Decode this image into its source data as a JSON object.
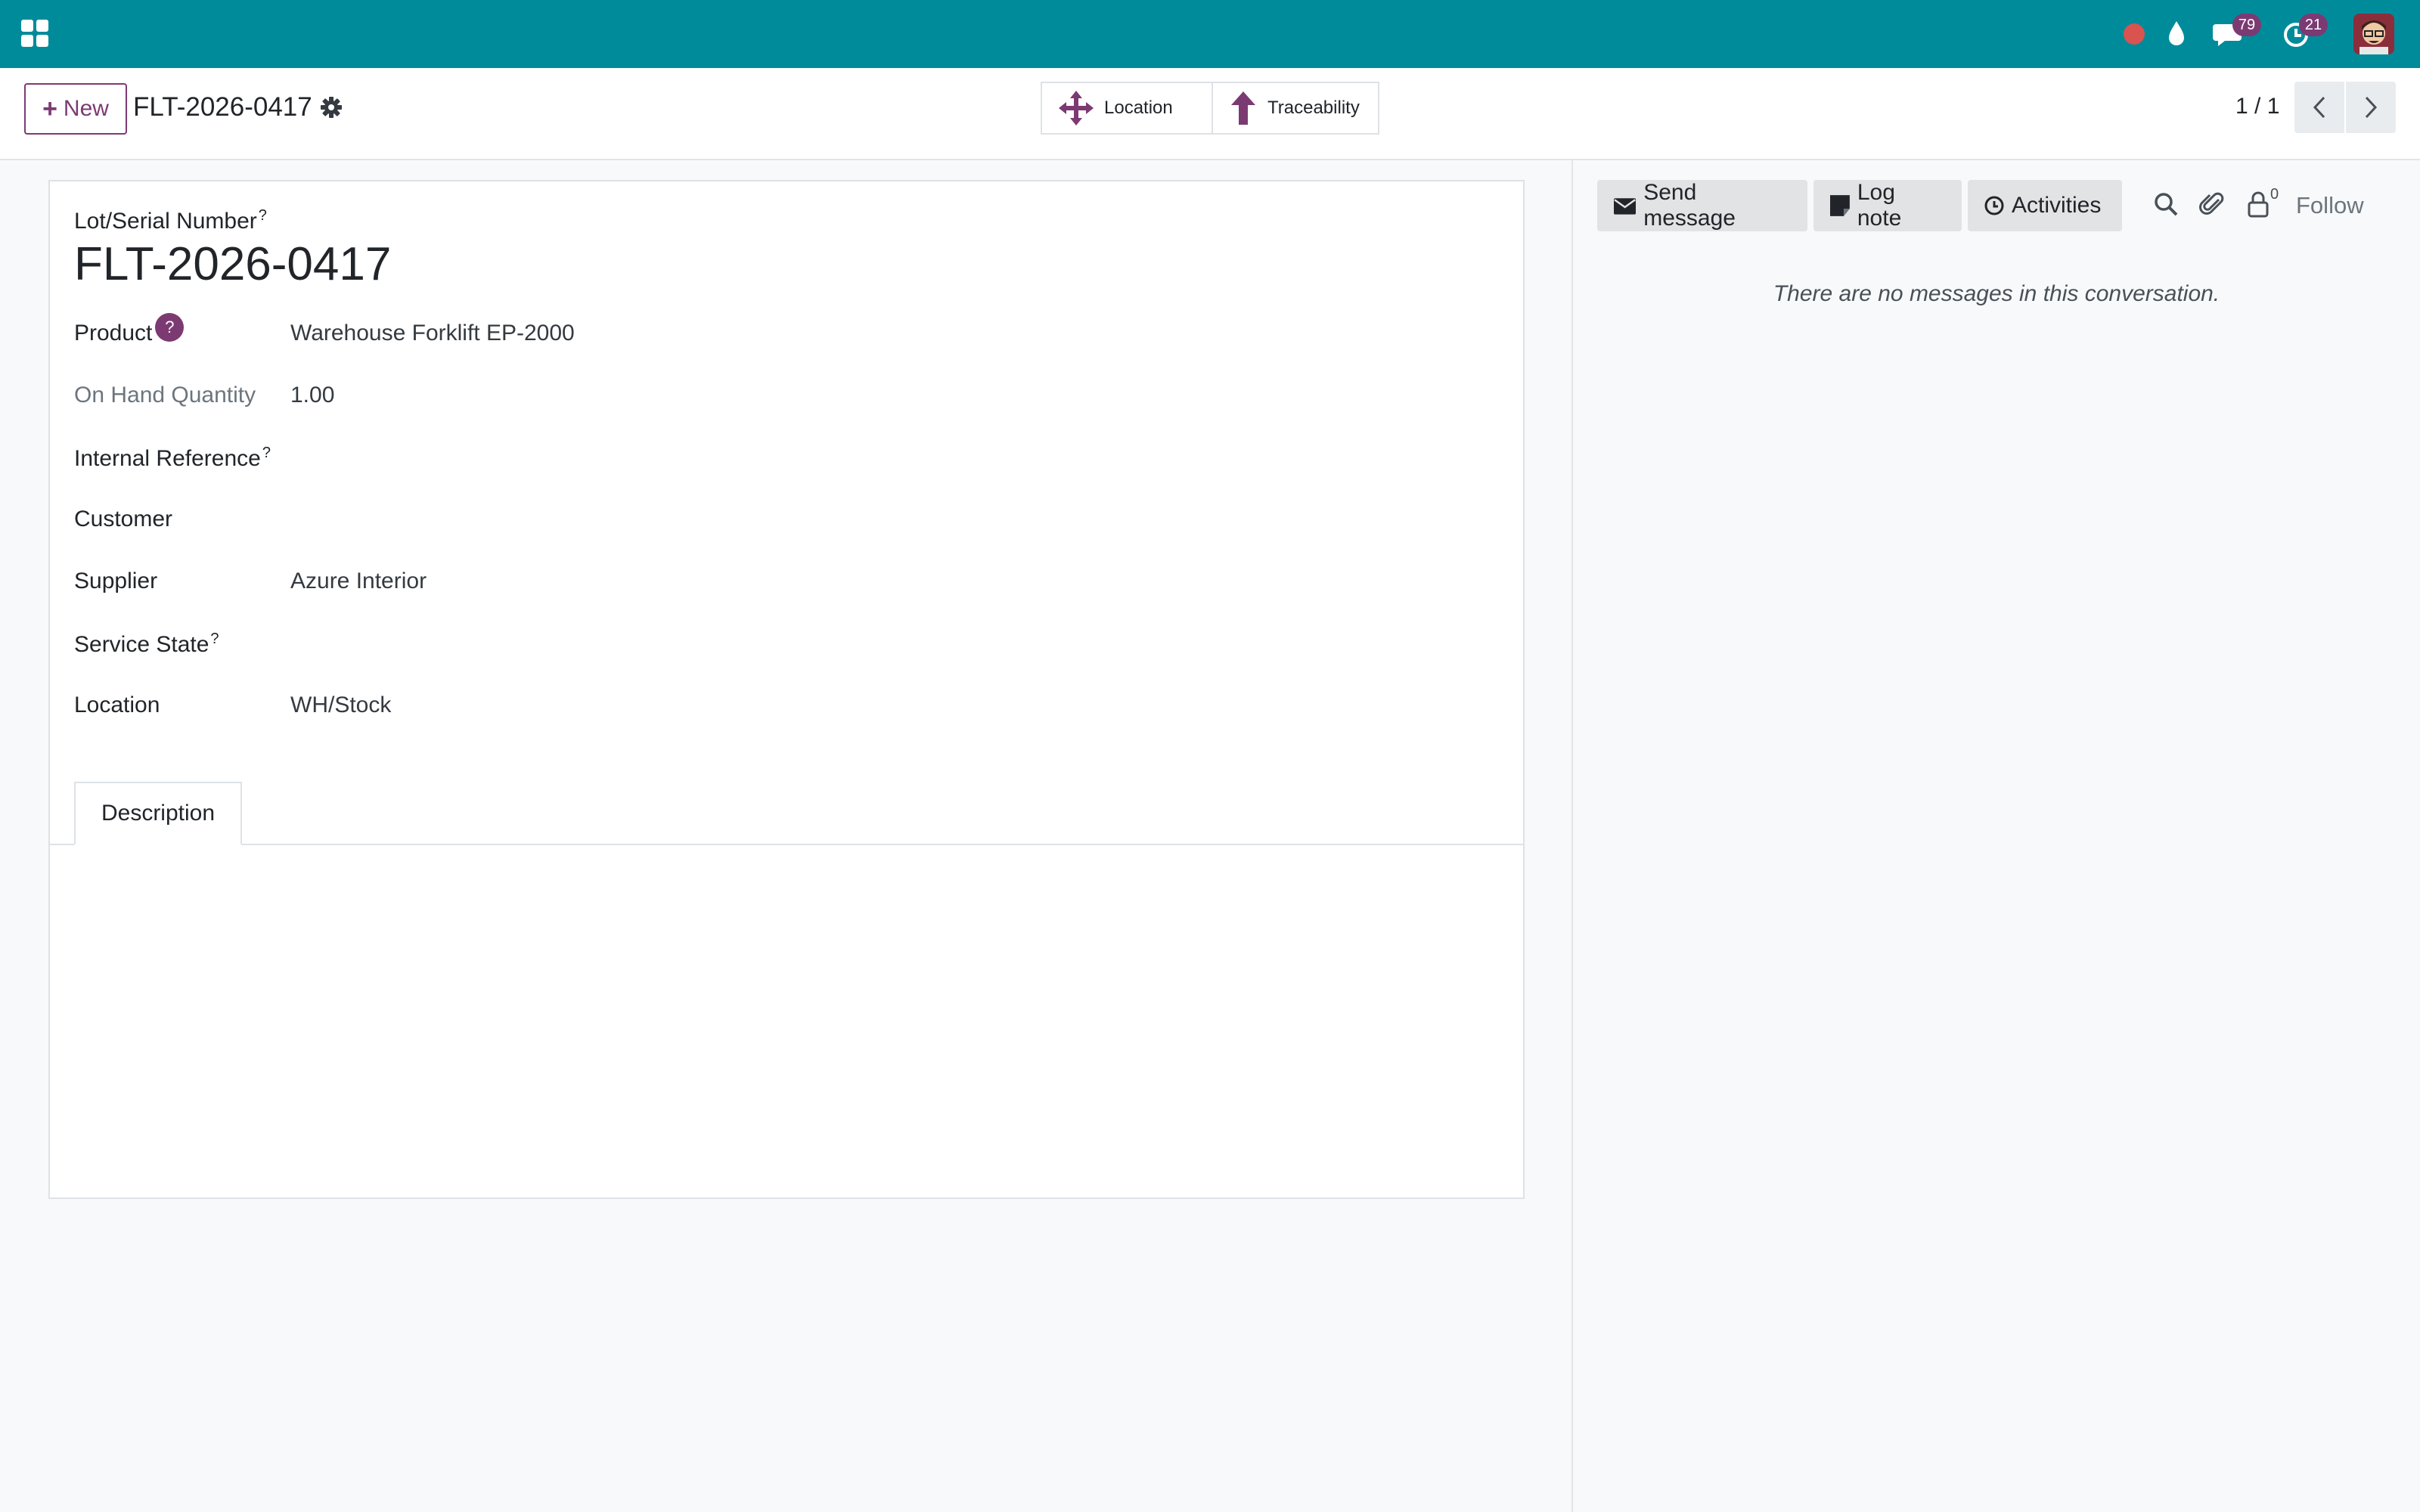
{
  "navbar": {
    "messages_badge": "79",
    "activities_badge": "21"
  },
  "control_panel": {
    "new_label": "New",
    "breadcrumb": "FLT-2026-0417",
    "smart_buttons": {
      "location_label": "Location",
      "traceability_label": "Traceability"
    },
    "pager": "1 / 1"
  },
  "form": {
    "lot_label": "Lot/Serial Number",
    "help_mark": "?",
    "record_name": "FLT-2026-0417",
    "fields": {
      "product": {
        "label": "Product",
        "value": "Warehouse Forklift EP-2000",
        "help": "?"
      },
      "on_hand": {
        "label": "On Hand Quantity",
        "value": "1.00"
      },
      "internal_ref": {
        "label": "Internal Reference",
        "value": ""
      },
      "customer": {
        "label": "Customer",
        "value": ""
      },
      "supplier": {
        "label": "Supplier",
        "value": "Azure Interior"
      },
      "service_state": {
        "label": "Service State",
        "value": ""
      },
      "location": {
        "label": "Location",
        "value": "WH/Stock"
      }
    },
    "tabs": [
      "Description"
    ]
  },
  "chatter": {
    "send_message": "Send message",
    "log_note": "Log note",
    "activities": "Activities",
    "follower_count": "0",
    "follow": "Follow",
    "empty": "There are no messages in this conversation."
  },
  "colors": {
    "navbar": "#008b9b",
    "accent": "#7c3a73",
    "record_dot": "#d9534f"
  }
}
